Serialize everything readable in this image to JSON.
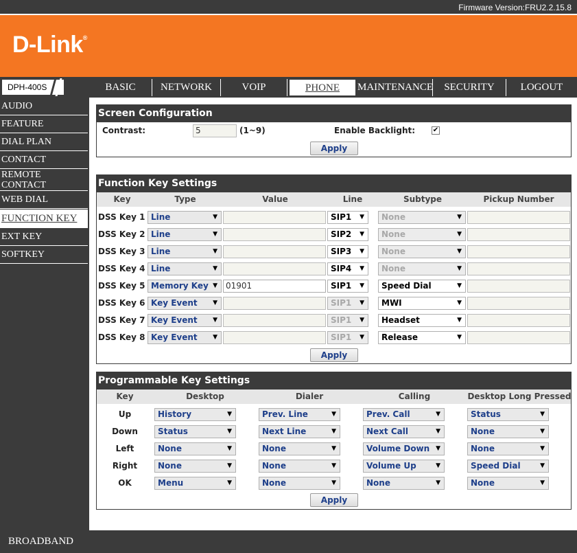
{
  "firmware": "Firmware Version:FRU2.2.15.8",
  "logo": {
    "text": "D-Link",
    "mark": "®"
  },
  "model": "DPH-400S",
  "tabs": [
    "BASIC",
    "NETWORK",
    "VOIP",
    "PHONE",
    "MAINTENANCE",
    "SECURITY",
    "LOGOUT"
  ],
  "sidebar": [
    "AUDIO",
    "FEATURE",
    "DIAL PLAN",
    "CONTACT",
    "REMOTE CONTACT",
    "WEB DIAL",
    "FUNCTION KEY",
    "EXT KEY",
    "SOFTKEY"
  ],
  "footer": "BROADBAND",
  "screen": {
    "title": "Screen Configuration",
    "contrast_label": "Contrast:",
    "contrast_value": "5",
    "contrast_range": "(1~9)",
    "backlight_label": "Enable Backlight:",
    "backlight_checked": "✔",
    "apply": "Apply"
  },
  "function_keys": {
    "title": "Function Key Settings",
    "headers": [
      "Key",
      "Type",
      "Value",
      "Line",
      "Subtype",
      "Pickup Number"
    ],
    "rows": [
      {
        "key": "DSS Key 1",
        "type": "Line",
        "value": "",
        "line": "SIP1",
        "subtype": "None",
        "pickup": ""
      },
      {
        "key": "DSS Key 2",
        "type": "Line",
        "value": "",
        "line": "SIP2",
        "subtype": "None",
        "pickup": ""
      },
      {
        "key": "DSS Key 3",
        "type": "Line",
        "value": "",
        "line": "SIP3",
        "subtype": "None",
        "pickup": ""
      },
      {
        "key": "DSS Key 4",
        "type": "Line",
        "value": "",
        "line": "SIP4",
        "subtype": "None",
        "pickup": ""
      },
      {
        "key": "DSS Key 5",
        "type": "Memory Key",
        "value": "01901",
        "line": "SIP1",
        "subtype": "Speed Dial",
        "pickup": ""
      },
      {
        "key": "DSS Key 6",
        "type": "Key Event",
        "value": "",
        "line": "SIP1",
        "subtype": "MWI",
        "pickup": ""
      },
      {
        "key": "DSS Key 7",
        "type": "Key Event",
        "value": "",
        "line": "SIP1",
        "subtype": "Headset",
        "pickup": ""
      },
      {
        "key": "DSS Key 8",
        "type": "Key Event",
        "value": "",
        "line": "SIP1",
        "subtype": "Release",
        "pickup": ""
      }
    ],
    "apply": "Apply"
  },
  "programmable_keys": {
    "title": "Programmable Key Settings",
    "headers": [
      "Key",
      "Desktop",
      "Dialer",
      "Calling",
      "Desktop Long Pressed"
    ],
    "rows": [
      {
        "key": "Up",
        "desktop": "History",
        "dialer": "Prev. Line",
        "calling": "Prev. Call",
        "long": "Status"
      },
      {
        "key": "Down",
        "desktop": "Status",
        "dialer": "Next Line",
        "calling": "Next Call",
        "long": "None"
      },
      {
        "key": "Left",
        "desktop": "None",
        "dialer": "None",
        "calling": "Volume Down",
        "long": "None"
      },
      {
        "key": "Right",
        "desktop": "None",
        "dialer": "None",
        "calling": "Volume Up",
        "long": "Speed Dial"
      },
      {
        "key": "OK",
        "desktop": "Menu",
        "dialer": "None",
        "calling": "None",
        "long": "None"
      }
    ],
    "apply": "Apply"
  }
}
